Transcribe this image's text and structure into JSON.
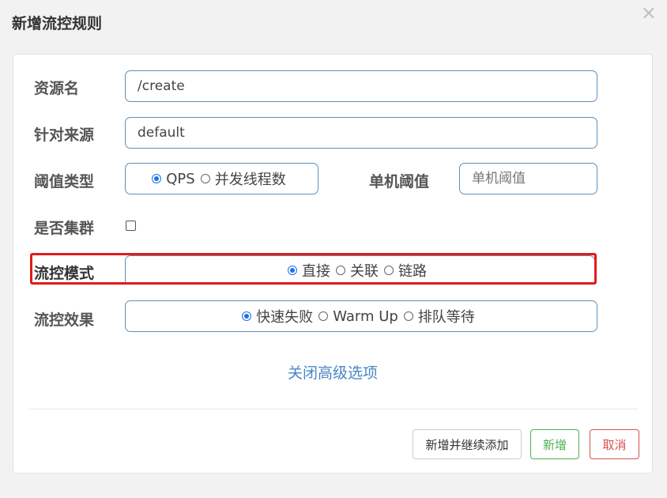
{
  "dialog": {
    "title": "新增流控规则",
    "close_symbol": "×"
  },
  "form": {
    "resource": {
      "label": "资源名",
      "value": "/create"
    },
    "source": {
      "label": "针对来源",
      "value": "default"
    },
    "threshold_type": {
      "label": "阈值类型",
      "options": [
        "QPS",
        "并发线程数"
      ],
      "selected": "QPS"
    },
    "single_threshold": {
      "label": "单机阈值",
      "value": "",
      "placeholder": "单机阈值"
    },
    "cluster": {
      "label": "是否集群",
      "checked": false
    },
    "flow_mode": {
      "label": "流控模式",
      "options": [
        "直接",
        "关联",
        "链路"
      ],
      "selected": "直接"
    },
    "flow_effect": {
      "label": "流控效果",
      "options": [
        "快速失败",
        "Warm Up",
        "排队等待"
      ],
      "selected": "快速失败"
    },
    "advanced_link": "关闭高级选项"
  },
  "footer": {
    "add_continue_label": "新增并继续添加",
    "add_label": "新增",
    "cancel_label": "取消"
  },
  "colors": {
    "highlight": "#e21b1b",
    "add": "#4caf50",
    "cancel": "#d9534f",
    "link": "#4a86c5"
  }
}
